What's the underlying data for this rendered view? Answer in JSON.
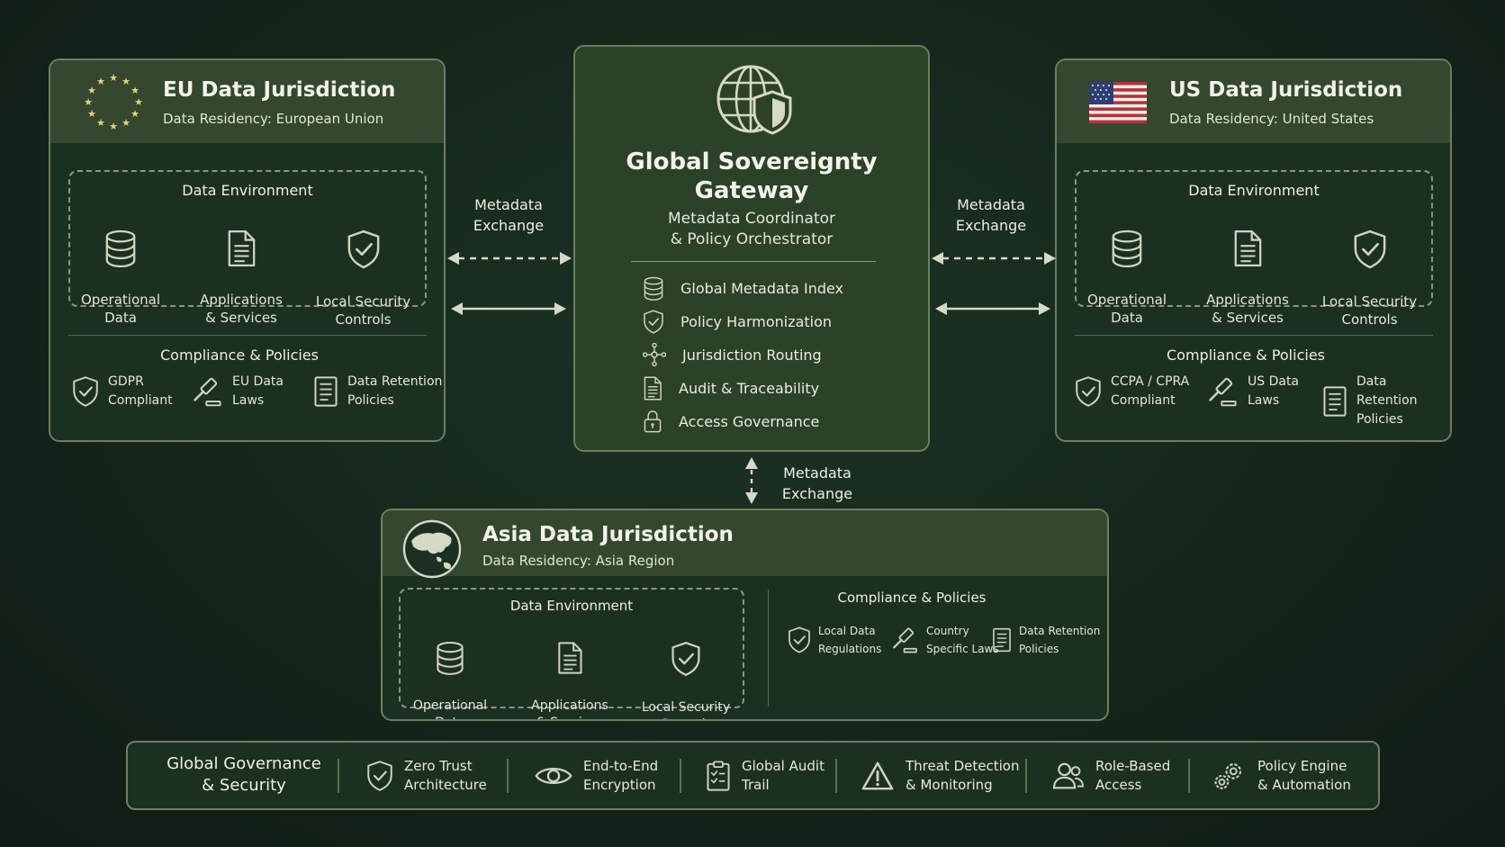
{
  "eu": {
    "title": "EU Data Jurisdiction",
    "subtitle": "Data Residency: European Union",
    "flag_icon": "eu-stars-flag",
    "env_title": "Data Environment",
    "env_items": [
      "Operational\nData",
      "Applications\n& Services",
      "Local Security\nControls"
    ],
    "compliance_title": "Compliance & Policies",
    "policies": [
      "GDPR\nCompliant",
      "EU Data\nLaws",
      "Data Retention\nPolicies"
    ]
  },
  "us": {
    "title": "US Data Jurisdiction",
    "subtitle": "Data Residency: United States",
    "flag_icon": "us-flag",
    "env_title": "Data Environment",
    "env_items": [
      "Operational\nData",
      "Applications\n& Services",
      "Local Security\nControls"
    ],
    "compliance_title": "Compliance & Policies",
    "policies": [
      "CCPA / CPRA\nCompliant",
      "US Data\nLaws",
      "Data Retention\nPolicies"
    ]
  },
  "asia": {
    "title": "Asia Data Jurisdiction",
    "subtitle": "Data Residency: Asia Region",
    "flag_icon": "globe-asia-icon",
    "env_title": "Data Environment",
    "env_items": [
      "Operational\nData",
      "Applications\n& Services",
      "Local Security\nControls"
    ],
    "compliance_title": "Compliance & Policies",
    "policies": [
      "Local Data\nRegulations",
      "Country\nSpecific Laws",
      "Data Retention\nPolicies"
    ]
  },
  "gateway": {
    "title_line1": "Global Sovereignty",
    "title_line2": "Gateway",
    "subtitle_line1": "Metadata Coordinator",
    "subtitle_line2": "& Policy Orchestrator",
    "features": [
      {
        "icon": "database-icon",
        "label": "Global Metadata Index"
      },
      {
        "icon": "shield-check-icon",
        "label": "Policy Harmonization"
      },
      {
        "icon": "routing-icon",
        "label": "Jurisdiction Routing"
      },
      {
        "icon": "document-icon",
        "label": "Audit & Traceability"
      },
      {
        "icon": "lock-icon",
        "label": "Access Governance"
      }
    ]
  },
  "connectors": {
    "left_label": "Metadata\nExchange",
    "right_label": "Metadata\nExchange",
    "bottom_label": "Metadata\nExchange"
  },
  "governance": {
    "title": "Global Governance\n& Security",
    "items": [
      {
        "icon": "shield-check-icon",
        "label": "Zero Trust\nArchitecture"
      },
      {
        "icon": "eye-icon",
        "label": "End-to-End\nEncryption"
      },
      {
        "icon": "clipboard-check-icon",
        "label": "Global Audit\nTrail"
      },
      {
        "icon": "warning-icon",
        "label": "Threat Detection\n& Monitoring"
      },
      {
        "icon": "users-icon",
        "label": "Role-Based\nAccess"
      },
      {
        "icon": "gears-icon",
        "label": "Policy Engine\n& Automation"
      }
    ]
  },
  "colors": {
    "background": "#142419",
    "panel": "#1c3022",
    "panel_header": "#33482f",
    "border": "#6f7d62",
    "icon": "#cfd4c0"
  }
}
